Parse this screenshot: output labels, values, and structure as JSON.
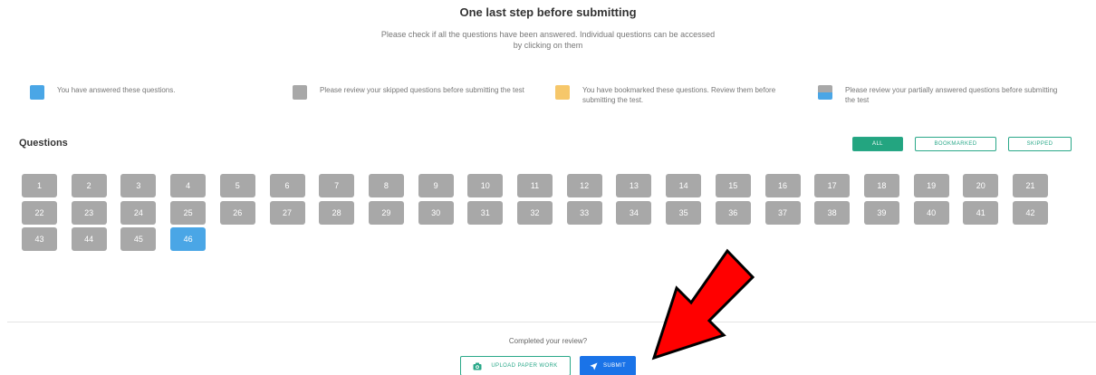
{
  "header": {
    "title": "One last step before submitting",
    "subtitle": "Please check if all the questions have been answered. Individual questions can be accessed by clicking on them"
  },
  "legend": [
    {
      "key": "answered",
      "color": "#4aa6e6",
      "text": "You have answered these questions."
    },
    {
      "key": "skipped",
      "color": "#a8a8a8",
      "text": "Please review your skipped questions before submitting the test"
    },
    {
      "key": "bookmarked",
      "color": "#f6c76a",
      "text": "You have bookmarked these questions. Review them before submitting the test."
    },
    {
      "key": "partial",
      "color": "#4aa6e6",
      "text": "Please review your partially answered questions before submitting the test"
    }
  ],
  "questions": {
    "heading": "Questions",
    "filters": [
      {
        "label": "ALL",
        "active": true
      },
      {
        "label": "BOOKMARKED",
        "active": false
      },
      {
        "label": "SKIPPED",
        "active": false
      }
    ],
    "total": 46,
    "answered": [
      46
    ]
  },
  "footer": {
    "review_text": "Completed your review?",
    "upload_label": "UPLOAD PAPER WORK",
    "submit_label": "SUBMIT"
  },
  "colors": {
    "answered": "#4aa6e6",
    "skipped": "#a8a8a8",
    "bookmarked": "#f6c76a",
    "accent_green": "#23a580",
    "submit_blue": "#1a73e8",
    "arrow_red": "#ff0000"
  },
  "icons": {
    "upload": "camera-icon",
    "submit": "send-icon",
    "annotation": "red-arrow"
  }
}
